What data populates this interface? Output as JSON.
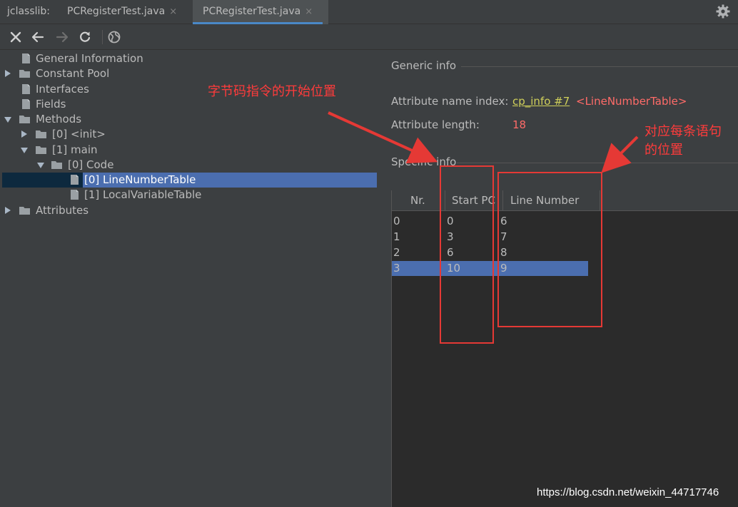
{
  "tabbar": {
    "prefix": "jclasslib:",
    "tabs": [
      {
        "label": "PCRegisterTest.java",
        "close": "×"
      },
      {
        "label": "PCRegisterTest.java",
        "close": "×"
      }
    ],
    "settings_icon": "gear-icon"
  },
  "toolbar": {
    "icons": [
      "close-icon",
      "back-icon",
      "forward-icon",
      "refresh-icon",
      "web-icon"
    ]
  },
  "tree": {
    "items": [
      {
        "label": "General Information",
        "icon": "file-icon"
      },
      {
        "label": "Constant Pool",
        "icon": "folder-icon",
        "expandable": true
      },
      {
        "label": "Interfaces",
        "icon": "file-icon"
      },
      {
        "label": "Fields",
        "icon": "file-icon"
      },
      {
        "label": "Methods",
        "icon": "folder-icon",
        "expanded": true
      },
      {
        "label": "[0] <init>",
        "icon": "folder-icon"
      },
      {
        "label": "[1] main",
        "icon": "folder-icon",
        "expanded": true
      },
      {
        "label": "[0] Code",
        "icon": "folder-icon",
        "expanded": true
      },
      {
        "label": "[0] LineNumberTable",
        "icon": "file-icon",
        "selected": true
      },
      {
        "label": "[1] LocalVariableTable",
        "icon": "file-icon"
      },
      {
        "label": "Attributes",
        "icon": "folder-icon"
      }
    ]
  },
  "generic": {
    "title": "Generic info",
    "name_index_label": "Attribute name index:",
    "name_index_link": "cp_info #7",
    "name_index_value": "<LineNumberTable>",
    "length_label": "Attribute length:",
    "length_value": "18"
  },
  "specific": {
    "title": "Specific info",
    "columns": [
      "Nr.",
      "Start PC",
      "Line Number"
    ],
    "rows": [
      [
        "0",
        "0",
        "6"
      ],
      [
        "1",
        "3",
        "7"
      ],
      [
        "2",
        "6",
        "8"
      ],
      [
        "3",
        "10",
        "9"
      ]
    ],
    "selected_row": 3
  },
  "annotations": {
    "start_pc_note": "字节码指令的开始位置",
    "line_note_1": "对应每条语句",
    "line_note_2": "的位置"
  },
  "watermark": "https://blog.csdn.net/weixin_44717746",
  "colors": {
    "background": "#3c3f41",
    "selection": "#4b6eaf",
    "link": "#d0d05a",
    "value_red": "#ff6b68",
    "annotation_red": "#e53935"
  }
}
